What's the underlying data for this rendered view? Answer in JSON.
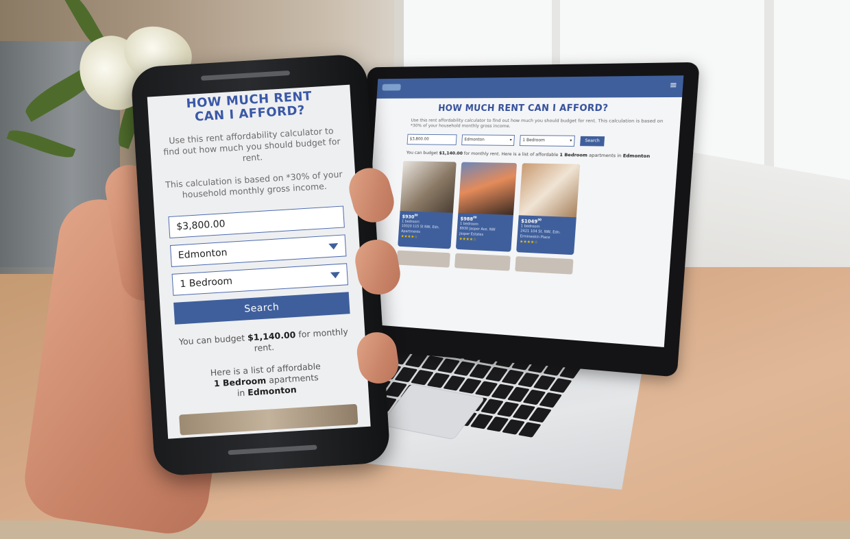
{
  "phone": {
    "title_line1": "HOW MUCH RENT",
    "title_line2": "CAN I AFFORD?",
    "intro": "Use this rent affordability calculator to find out how much you should budget for rent.",
    "basis": "This calculation is based on *30% of your household monthly gross income.",
    "income_value": "$3,800.00",
    "city_value": "Edmonton",
    "bedroom_value": "1 Bedroom",
    "search_label": "Search",
    "budget_prefix": "You can budget ",
    "budget_amount": "$1,140.00",
    "budget_suffix": " for monthly rent.",
    "list_prefix": "Here is a list of affordable",
    "list_bedroom": "1 Bedroom",
    "list_mid": " apartments",
    "list_in": "in ",
    "list_city": "Edmonton"
  },
  "laptop": {
    "menu_icon": "≡",
    "title": "HOW MUCH RENT CAN I AFFORD?",
    "intro": "Use this rent affordability calculator to find out how much you should budget for rent. This calculation is based on *30% of your household monthly gross income.",
    "income_value": "$3,800.00",
    "city_value": "Edmonton",
    "bedroom_value": "1 Bedroom",
    "search_label": "Search",
    "budget_prefix": "You can budget ",
    "budget_amount": "$1,140.00",
    "budget_mid": " for monthly rent. Here is a list of affordable ",
    "budget_bedroom": "1 Bedroom",
    "budget_suffix": " apartments in ",
    "budget_city": "Edmonton",
    "listings": [
      {
        "price": "$930",
        "cents": "00",
        "beds": "1 bedroom",
        "address": "10020 115 St NW, Edn.",
        "name": "Apartments",
        "stars": "★★★★☆"
      },
      {
        "price": "$988",
        "cents": "00",
        "beds": "1 bedroom",
        "address": "8930 Jasper Ave. NW",
        "name": "Jasper Estates",
        "stars": "★★★★☆"
      },
      {
        "price": "$1049",
        "cents": "00",
        "beds": "1 bedroom",
        "address": "2421 104 St. NW, Edn.",
        "name": "Ermineskin Place",
        "stars": "★★★★☆"
      }
    ]
  },
  "colors": {
    "brand_blue": "#3f5f9c",
    "title_blue": "#3a58a6",
    "star_yellow": "#f2c200"
  },
  "icons": [
    "menu-icon",
    "dropdown-arrow-icon"
  ]
}
